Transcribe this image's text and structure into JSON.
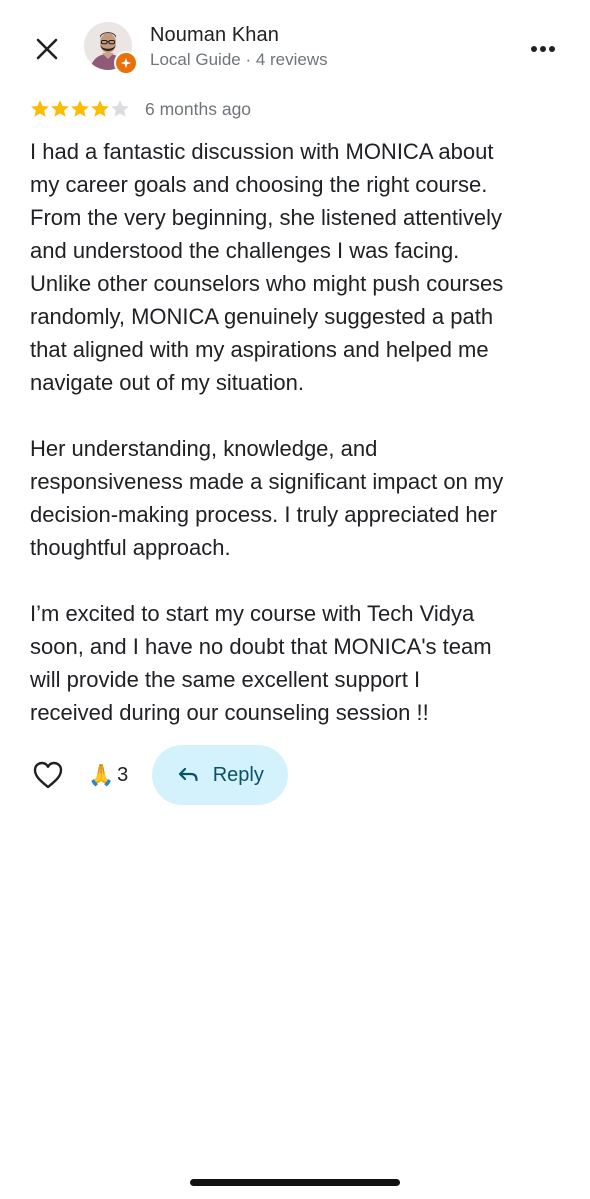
{
  "header": {
    "close_icon": "close-icon",
    "more_icon": "more-horizontal-icon"
  },
  "reviewer": {
    "name": "Nouman Khan",
    "subline": "Local Guide · 4 reviews",
    "badge_icon": "local-guide-star-icon",
    "badge_color": "#e8710a"
  },
  "rating": {
    "stars_filled": 4,
    "stars_total": 5,
    "star_color": "#fbbc04",
    "time_ago": "6 months ago"
  },
  "review": {
    "paragraphs": [
      "I had a fantastic discussion with MONICA about\nmy career goals and choosing the right course.\nFrom the very beginning, she listened attentively\nand understood the challenges I was facing.\nUnlike other counselors who might push courses\nrandomly, MONICA genuinely suggested a path\nthat aligned with my aspirations and helped me\nnavigate out of my situation.",
      "Her understanding, knowledge, and\nresponsiveness made a significant impact on my\ndecision-making process. I truly appreciated her\nthoughtful approach.",
      "I’m excited to start my course with Tech Vidya\nsoon, and I have no doubt that MONICA's team\nwill provide the same excellent support I\nreceived during our counseling session !!"
    ]
  },
  "actions": {
    "like_icon": "heart-outline-icon",
    "reaction_emoji": "🙏",
    "reaction_count": "3",
    "reply_icon": "reply-arrow-icon",
    "reply_label": "Reply",
    "reply_bg": "#d3f2fb"
  }
}
